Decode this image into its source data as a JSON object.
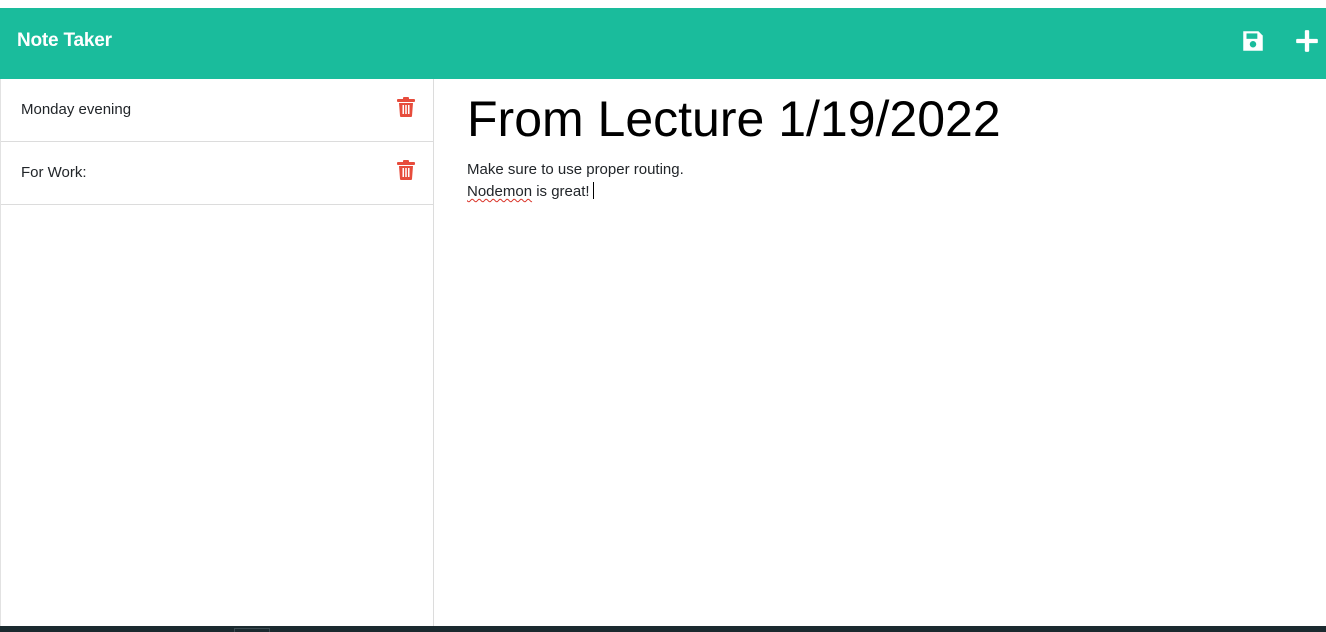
{
  "app": {
    "brand": "Note Taker"
  },
  "toolbar": {
    "save_icon": "floppy-disk-icon",
    "add_icon": "plus-icon"
  },
  "sidebar": {
    "items": [
      {
        "label": "Monday evening",
        "icon": "trash-icon"
      },
      {
        "label": "For Work:",
        "icon": "trash-icon"
      }
    ]
  },
  "editor": {
    "title": "From Lecture 1/19/2022",
    "lines": {
      "line1": "Make sure to use proper routing.",
      "line2_word_misspelled": "Nodemon",
      "line2_rest": " is great!"
    }
  },
  "colors": {
    "navbar": "#1abc9c",
    "trash": "#e74c3c",
    "text": "#212529"
  }
}
